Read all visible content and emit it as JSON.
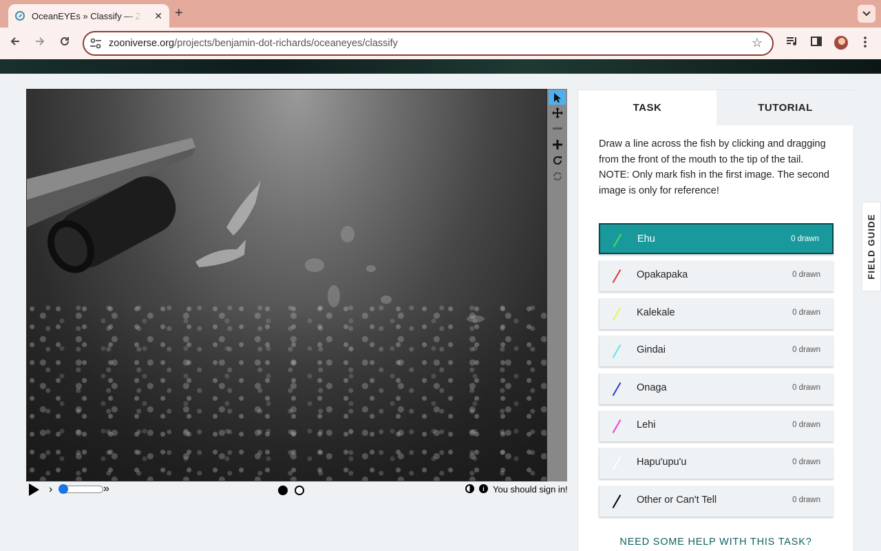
{
  "browser": {
    "tab_title": "OceanEYEs » Classify — Zooniverse",
    "tab_close": "✕",
    "new_tab": "+",
    "url_host": "zooniverse.org",
    "url_path": "/projects/benjamin-dot-richards/oceaneyes/classify"
  },
  "viewer": {
    "tools": [
      {
        "name": "pointer-icon",
        "glyph": "➤"
      },
      {
        "name": "move-icon",
        "glyph": "✥"
      },
      {
        "name": "zoom-out-icon",
        "glyph": "−"
      },
      {
        "name": "zoom-in-icon",
        "glyph": "+"
      },
      {
        "name": "rotate-icon",
        "glyph": "↻"
      },
      {
        "name": "reset-icon",
        "glyph": "⟳"
      }
    ],
    "step_back": "›",
    "step_forward": "»",
    "info_glyph": "i",
    "signin_text": "You should sign in!",
    "frames_total": 2,
    "current_frame": 1,
    "playback_position": 0.0
  },
  "panel": {
    "tabs": {
      "task": "TASK",
      "tutorial": "TUTORIAL"
    },
    "instruction_line1": "Draw a line across the fish by clicking and dragging from the front of the mouth to the tip of the tail.",
    "instruction_line2": "NOTE: Only mark fish in the first image. The second image is only for reference!",
    "choices": [
      {
        "label": "Ehu",
        "count": "0 drawn",
        "color": "#43e05a"
      },
      {
        "label": "Opakapaka",
        "count": "0 drawn",
        "color": "#e0323a"
      },
      {
        "label": "Kalekale",
        "count": "0 drawn",
        "color": "#f1ef5a"
      },
      {
        "label": "Gindai",
        "count": "0 drawn",
        "color": "#5fe4ef"
      },
      {
        "label": "Onaga",
        "count": "0 drawn",
        "color": "#2f3bd1"
      },
      {
        "label": "Lehi",
        "count": "0 drawn",
        "color": "#ef3ad6"
      },
      {
        "label": "Hapu'upu'u",
        "count": "0 drawn",
        "color": "#ffffff"
      },
      {
        "label": "Other or Can't Tell",
        "count": "0 drawn",
        "color": "#000000"
      }
    ],
    "selected_index": 0,
    "help_link": "NEED SOME HELP WITH THIS TASK?"
  },
  "field_guide": "FIELD GUIDE"
}
